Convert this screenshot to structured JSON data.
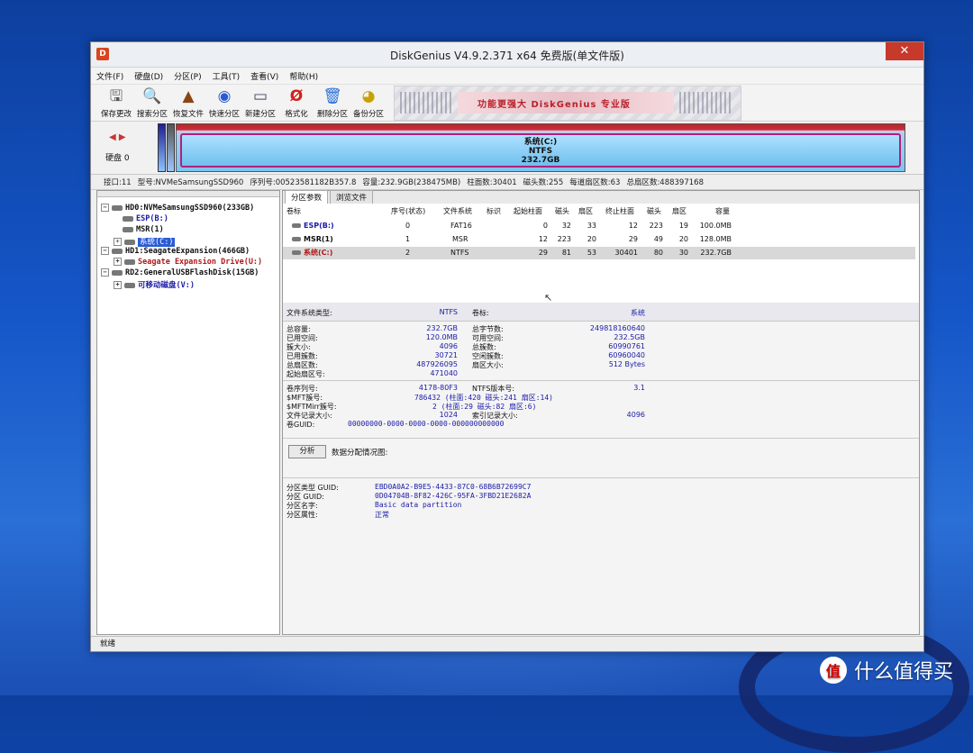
{
  "window": {
    "title": "DiskGenius V4.9.2.371 x64 免费版(单文件版)",
    "close": "✕"
  },
  "menu": [
    "文件(F)",
    "硬盘(D)",
    "分区(P)",
    "工具(T)",
    "查看(V)",
    "帮助(H)"
  ],
  "toolbar": [
    {
      "label": "保存更改",
      "icon": "save-icon"
    },
    {
      "label": "搜索分区",
      "icon": "search-icon"
    },
    {
      "label": "恢复文件",
      "icon": "recover-icon"
    },
    {
      "label": "快速分区",
      "icon": "quick-partition-icon"
    },
    {
      "label": "新建分区",
      "icon": "new-partition-icon"
    },
    {
      "label": "格式化",
      "icon": "format-icon"
    },
    {
      "label": "删除分区",
      "icon": "delete-icon"
    },
    {
      "label": "备份分区",
      "icon": "backup-icon"
    }
  ],
  "banner": {
    "text": "功能更强大 DiskGenius 专业版"
  },
  "diskmap": {
    "label": "硬盘 0",
    "partition_name": "系统(C:)",
    "partition_fs": "NTFS",
    "partition_size": "232.7GB"
  },
  "diskinfo": {
    "iface": "接口:11",
    "model": "型号:NVMeSamsungSSD960",
    "serial": "序列号:00523581182B357.8",
    "capacity": "容量:232.9GB(238475MB)",
    "cylinders": "柱面数:30401",
    "heads": "磁头数:255",
    "sectors_per_track": "每道扇区数:63",
    "total_sectors": "总扇区数:488397168"
  },
  "tree": {
    "hd0": "HD0:NVMeSamsungSSD960(233GB)",
    "esp": "ESP(B:)",
    "msr": "MSR(1)",
    "sys": "系统(C:)",
    "hd1": "HD1:SeagateExpansion(466GB)",
    "seagate": "Seagate Expansion Drive(U:)",
    "rd2": "RD2:GeneralUSBFlashDisk(15GB)",
    "removable": "可移动磁盘(V:)"
  },
  "tabs": [
    "分区参数",
    "浏览文件"
  ],
  "table": {
    "headers": [
      "卷标",
      "序号(状态)",
      "文件系统",
      "标识",
      "起始柱面",
      "磁头",
      "扇区",
      "终止柱面",
      "磁头",
      "扇区",
      "容量"
    ],
    "rows": [
      {
        "label": "ESP(B:)",
        "idx": "0",
        "fs": "FAT16",
        "flag": "",
        "sc": "0",
        "sh": "32",
        "ss": "33",
        "ec": "12",
        "eh": "223",
        "es": "19",
        "cap": "100.0MB"
      },
      {
        "label": "MSR(1)",
        "idx": "1",
        "fs": "MSR",
        "flag": "",
        "sc": "12",
        "sh": "223",
        "ss": "20",
        "ec": "29",
        "eh": "49",
        "es": "20",
        "cap": "128.0MB"
      },
      {
        "label": "系统(C:)",
        "idx": "2",
        "fs": "NTFS",
        "flag": "",
        "sc": "29",
        "sh": "81",
        "ss": "53",
        "ec": "30401",
        "eh": "80",
        "es": "30",
        "cap": "232.7GB"
      }
    ]
  },
  "info": {
    "fs_type_label": "文件系统类型:",
    "fs_type_value": "NTFS",
    "vol_label_label": "卷标:",
    "vol_label_value": "系统",
    "total_cap_label": "总容量:",
    "total_cap": "232.7GB",
    "total_bytes_label": "总字节数:",
    "total_bytes": "249818160640",
    "used_label": "已用空间:",
    "used": "120.0MB",
    "free_label": "可用空间:",
    "free": "232.5GB",
    "cluster_size_label": "簇大小:",
    "cluster_size": "4096",
    "total_clusters_label": "总簇数:",
    "total_clusters": "60990761",
    "used_clusters_label": "已用簇数:",
    "used_clusters": "30721",
    "free_clusters_label": "空闲簇数:",
    "free_clusters": "60960040",
    "total_sectors_label": "总扇区数:",
    "total_sectors": "487926095",
    "sector_size_label": "扇区大小:",
    "sector_size": "512 Bytes",
    "start_sector_label": "起始扇区号:",
    "start_sector": "471040",
    "serial_label": "卷序列号:",
    "serial": "4178-80F3",
    "ntfs_ver_label": "NTFS版本号:",
    "ntfs_ver": "3.1",
    "mft_label": "$MFT簇号:",
    "mft": "786432 (柱面:420 磁头:241 扇区:14)",
    "mftmirr_label": "$MFTMirr簇号:",
    "mftmirr": "2 (柱面:29 磁头:82 扇区:6)",
    "rec_size_label": "文件记录大小:",
    "rec_size": "1024",
    "idx_size_label": "索引记录大小:",
    "idx_size": "4096",
    "guid_label": "卷GUID:",
    "guid": "00000000-0000-0000-0000-000000000000",
    "analyze_btn": "分析",
    "alloc_label": "数据分配情况图:",
    "ptype_guid_label": "分区类型 GUID:",
    "ptype_guid": "EBD0A0A2-B9E5-4433-87C0-68B6B72699C7",
    "part_guid_label": "分区 GUID:",
    "part_guid": "0D04704B-8F82-426C-95FA-3FBD21E2682A",
    "part_name_label": "分区名字:",
    "part_name": "Basic data partition",
    "part_attr_label": "分区属性:",
    "part_attr": "正常"
  },
  "status": "就绪",
  "watermark": "什么值得买",
  "watermark_icon": "值"
}
